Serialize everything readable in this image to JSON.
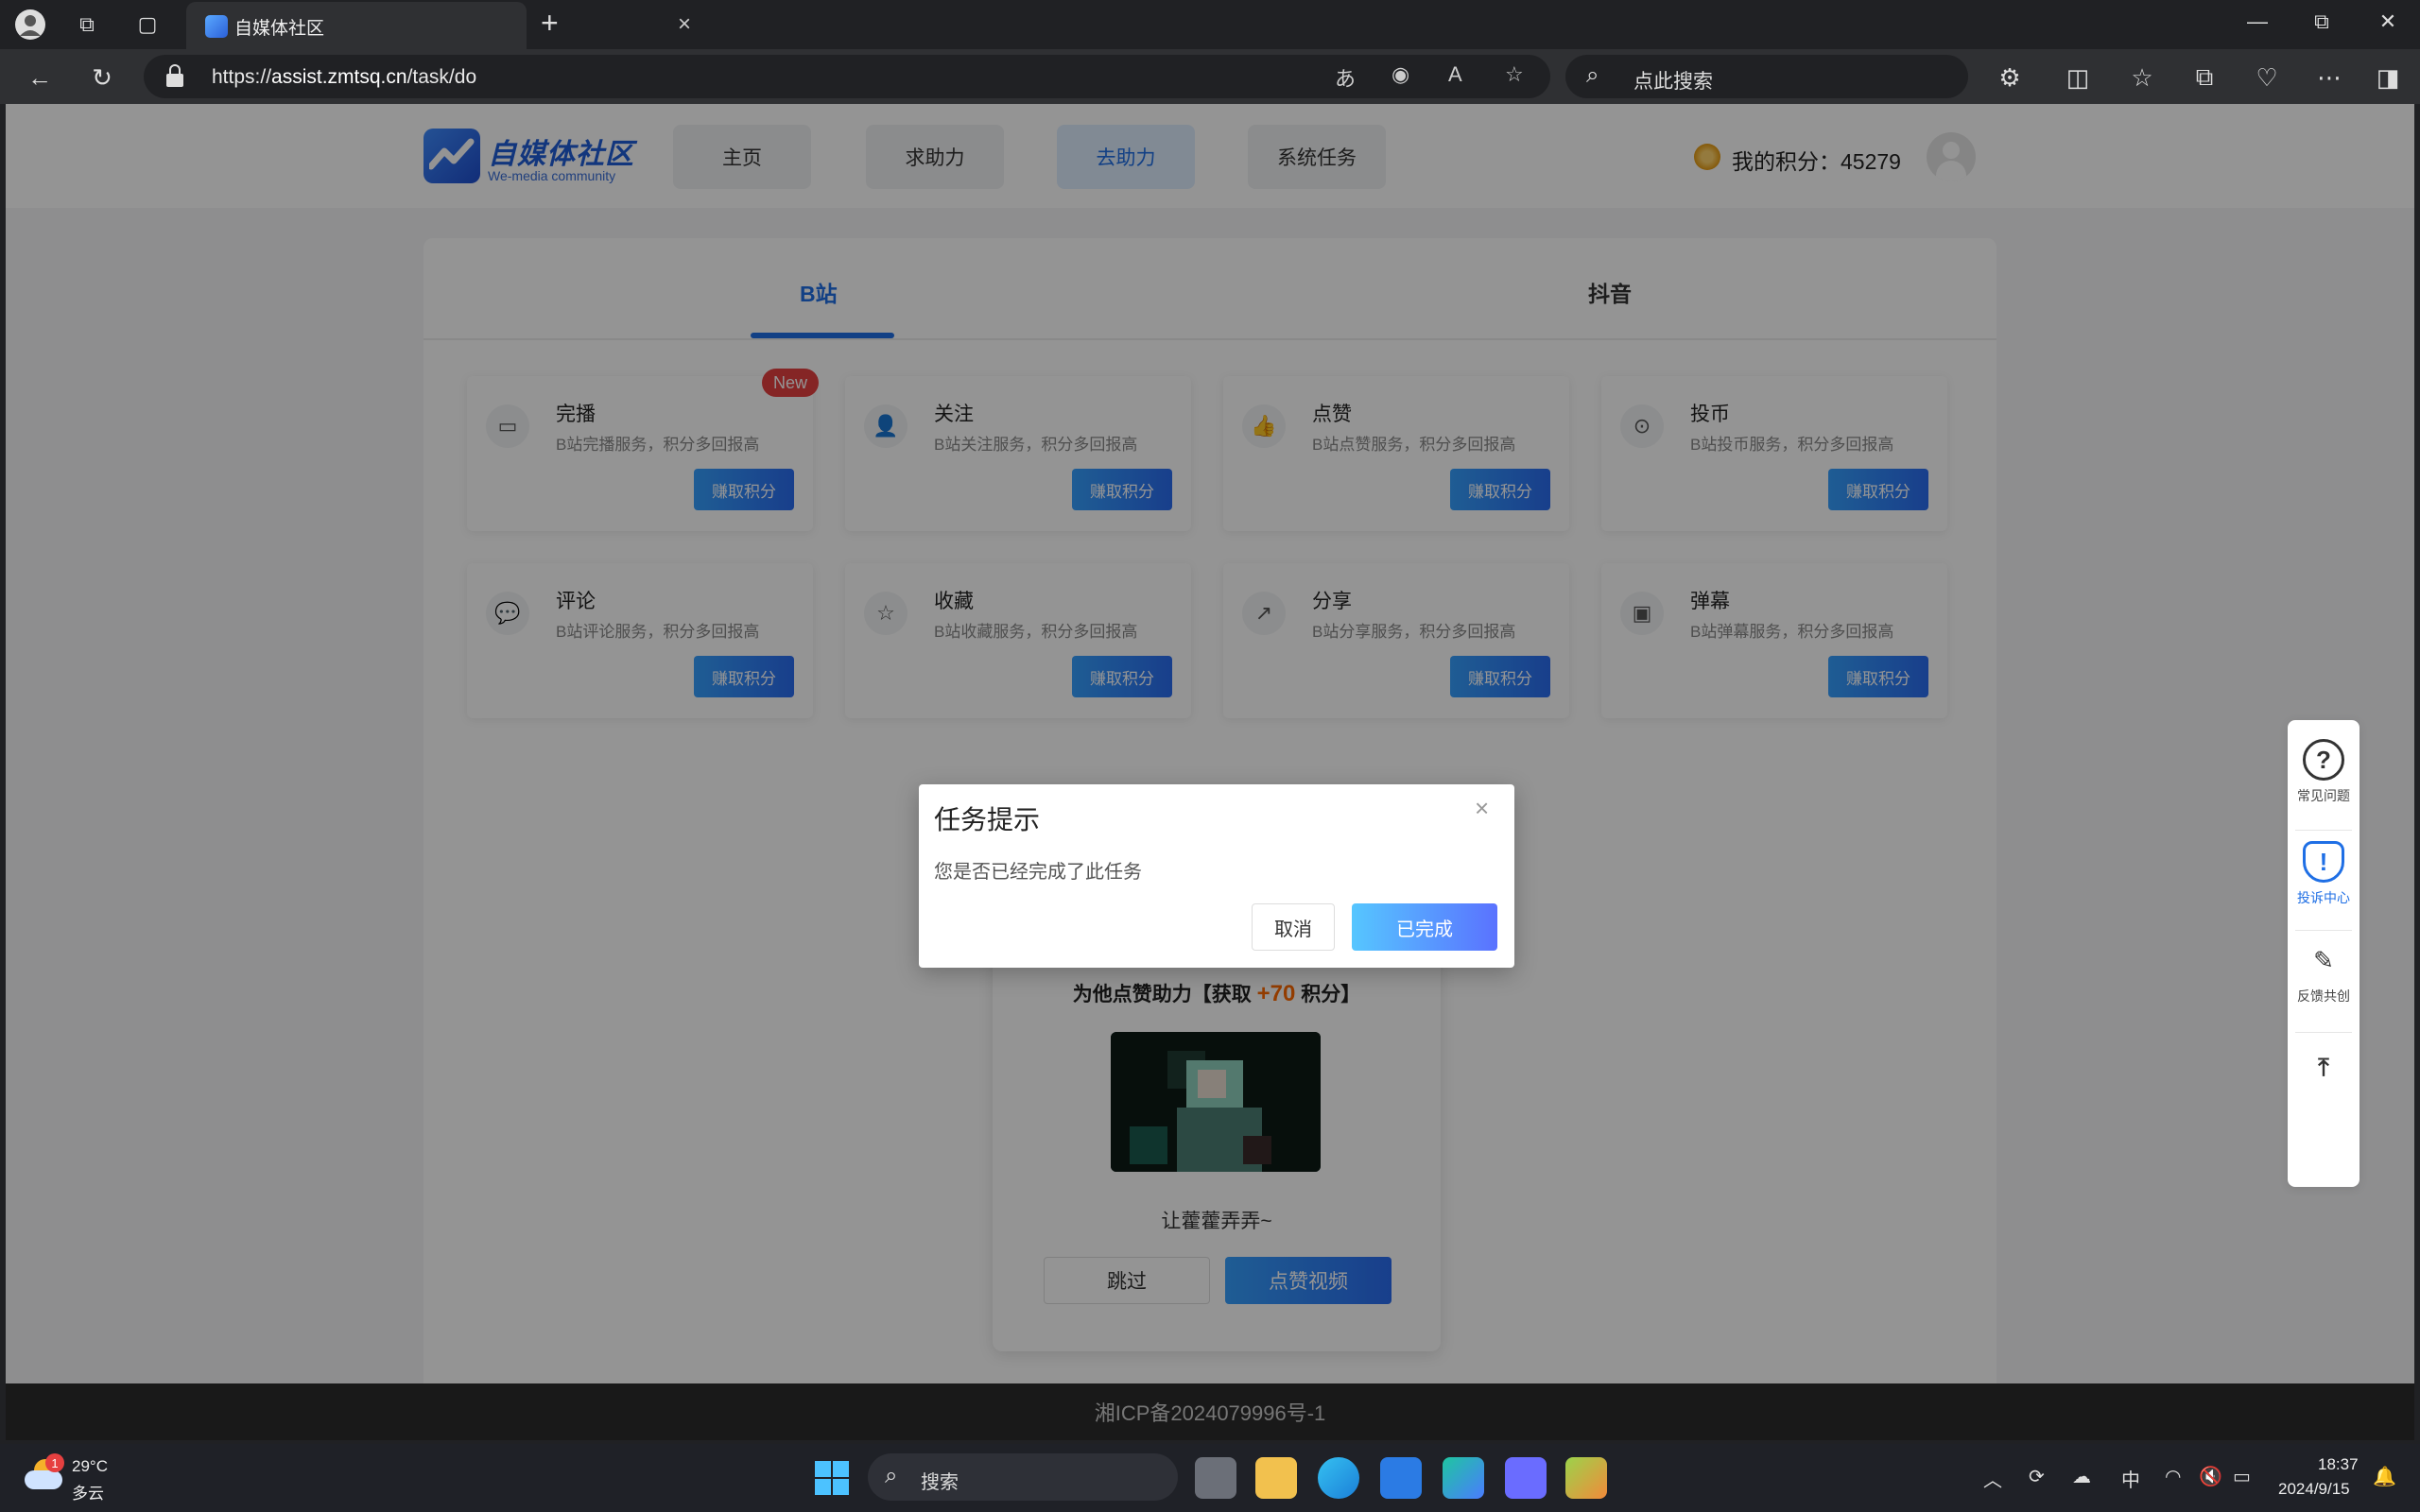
{
  "browser": {
    "tab_title": "自媒体社区",
    "url_prefix": "https://",
    "url_host": "assist.zmtsq.cn",
    "url_path": "/task/do",
    "search_placeholder": "点此搜索"
  },
  "header": {
    "logo_cn": "自媒体社区",
    "logo_en": "We-media community",
    "nav": [
      {
        "label": "主页"
      },
      {
        "label": "求助力"
      },
      {
        "label": "去助力"
      },
      {
        "label": "系统任务"
      }
    ],
    "points_label": "我的积分：",
    "points_value": "45279"
  },
  "platform_tabs": [
    {
      "label": "B站"
    },
    {
      "label": "抖音"
    }
  ],
  "services": [
    {
      "name": "完播",
      "desc": "B站完播服务，积分多回报高",
      "button": "赚取积分",
      "badge": "New",
      "icon": "tv-icon"
    },
    {
      "name": "关注",
      "desc": "B站关注服务，积分多回报高",
      "button": "赚取积分",
      "icon": "user-plus-icon"
    },
    {
      "name": "点赞",
      "desc": "B站点赞服务，积分多回报高",
      "button": "赚取积分",
      "icon": "thumb-up-icon"
    },
    {
      "name": "投币",
      "desc": "B站投币服务，积分多回报高",
      "button": "赚取积分",
      "icon": "coin-icon"
    },
    {
      "name": "评论",
      "desc": "B站评论服务，积分多回报高",
      "button": "赚取积分",
      "icon": "comment-icon"
    },
    {
      "name": "收藏",
      "desc": "B站收藏服务，积分多回报高",
      "button": "赚取积分",
      "icon": "star-icon"
    },
    {
      "name": "分享",
      "desc": "B站分享服务，积分多回报高",
      "button": "赚取积分",
      "icon": "share-icon"
    },
    {
      "name": "弹幕",
      "desc": "B站弹幕服务，积分多回报高",
      "button": "赚取积分",
      "icon": "danmaku-icon"
    }
  ],
  "task_card": {
    "title_prefix": "为他点赞助力【获取",
    "points": "+70",
    "title_suffix": "积分】",
    "video_title": "让藿藿弄弄~",
    "skip": "跳过",
    "like": "点赞视频"
  },
  "side_tools": [
    {
      "label": "常见问题"
    },
    {
      "label": "投诉中心"
    },
    {
      "label": "反馈共创"
    }
  ],
  "footer": {
    "icp": "湘ICP备2024079996号-1"
  },
  "modal": {
    "title": "任务提示",
    "message": "您是否已经完成了此任务",
    "cancel": "取消",
    "confirm": "已完成"
  },
  "taskbar": {
    "weather_badge": "1",
    "temperature": "29°C",
    "weather": "多云",
    "search_placeholder": "搜索",
    "ime": "中",
    "time": "18:37",
    "date": "2024/9/15"
  }
}
